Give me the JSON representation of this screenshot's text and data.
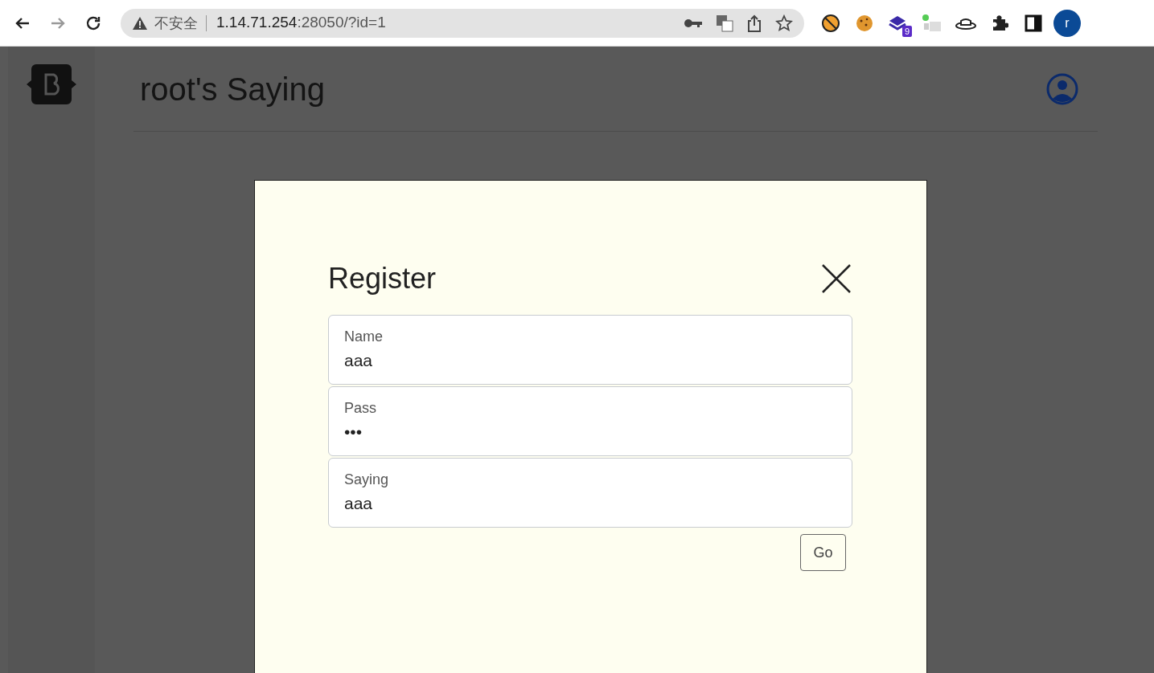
{
  "browser": {
    "nav_buttons": [
      {
        "kind": "back",
        "disabled": false
      },
      {
        "kind": "forward",
        "disabled": true
      },
      {
        "kind": "reload",
        "disabled": false
      }
    ],
    "security_label": "不安全",
    "url_host": "1.14.71.254",
    "url_rest": ":28050/?id=1",
    "extension_badge": "9",
    "profile_letter": "r"
  },
  "page": {
    "title": "root's Saying"
  },
  "modal": {
    "title": "Register",
    "fields": [
      {
        "label": "Name",
        "value": "aaa"
      },
      {
        "label": "Pass",
        "value": "•••"
      },
      {
        "label": "Saying",
        "value": "aaa"
      }
    ],
    "submit": "Go"
  }
}
